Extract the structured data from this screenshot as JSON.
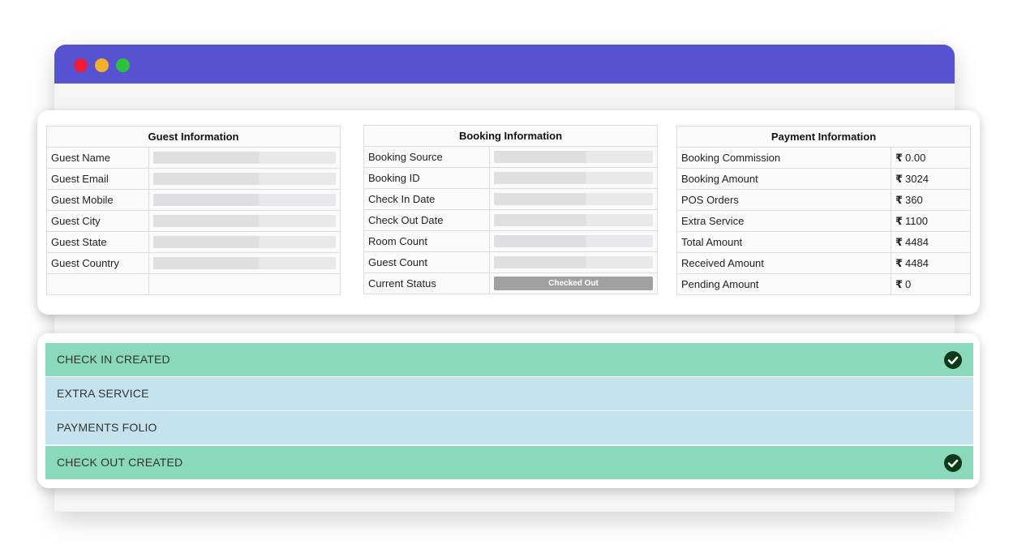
{
  "guest_info": {
    "title": "Guest Information",
    "rows": [
      {
        "label": "Guest Name"
      },
      {
        "label": "Guest Email"
      },
      {
        "label": "Guest Mobile"
      },
      {
        "label": "Guest City"
      },
      {
        "label": "Guest State"
      },
      {
        "label": "Guest Country"
      },
      {
        "label": ""
      }
    ]
  },
  "booking_info": {
    "title": "Booking Information",
    "rows": [
      {
        "label": "Booking Source"
      },
      {
        "label": "Booking ID"
      },
      {
        "label": "Check In Date"
      },
      {
        "label": "Check Out Date"
      },
      {
        "label": "Room Count"
      },
      {
        "label": "Guest Count"
      },
      {
        "label": "Current Status",
        "value": "Checked Out"
      }
    ]
  },
  "payment_info": {
    "title": "Payment Information",
    "currency": "₹",
    "rows": [
      {
        "label": "Booking Commission",
        "value": "0.00"
      },
      {
        "label": "Booking Amount",
        "value": "3024"
      },
      {
        "label": "POS Orders",
        "value": "360"
      },
      {
        "label": "Extra Service",
        "value": "1100"
      },
      {
        "label": "Total Amount",
        "value": "4484"
      },
      {
        "label": "Received Amount",
        "value": "4484"
      },
      {
        "label": "Pending Amount",
        "value": "0"
      }
    ]
  },
  "steps": [
    {
      "label": "CHECK IN CREATED",
      "status": "done"
    },
    {
      "label": "EXTRA SERVICE",
      "status": "pending"
    },
    {
      "label": "PAYMENTS FOLIO",
      "status": "pending"
    },
    {
      "label": "CHECK OUT CREATED",
      "status": "done"
    }
  ],
  "colors": {
    "titlebar": "#5752d0",
    "step_done": "#89d9ba",
    "step_pending": "#c4e3ee",
    "check_icon": "#0c3b19",
    "status_badge": "#a0a0a0"
  }
}
